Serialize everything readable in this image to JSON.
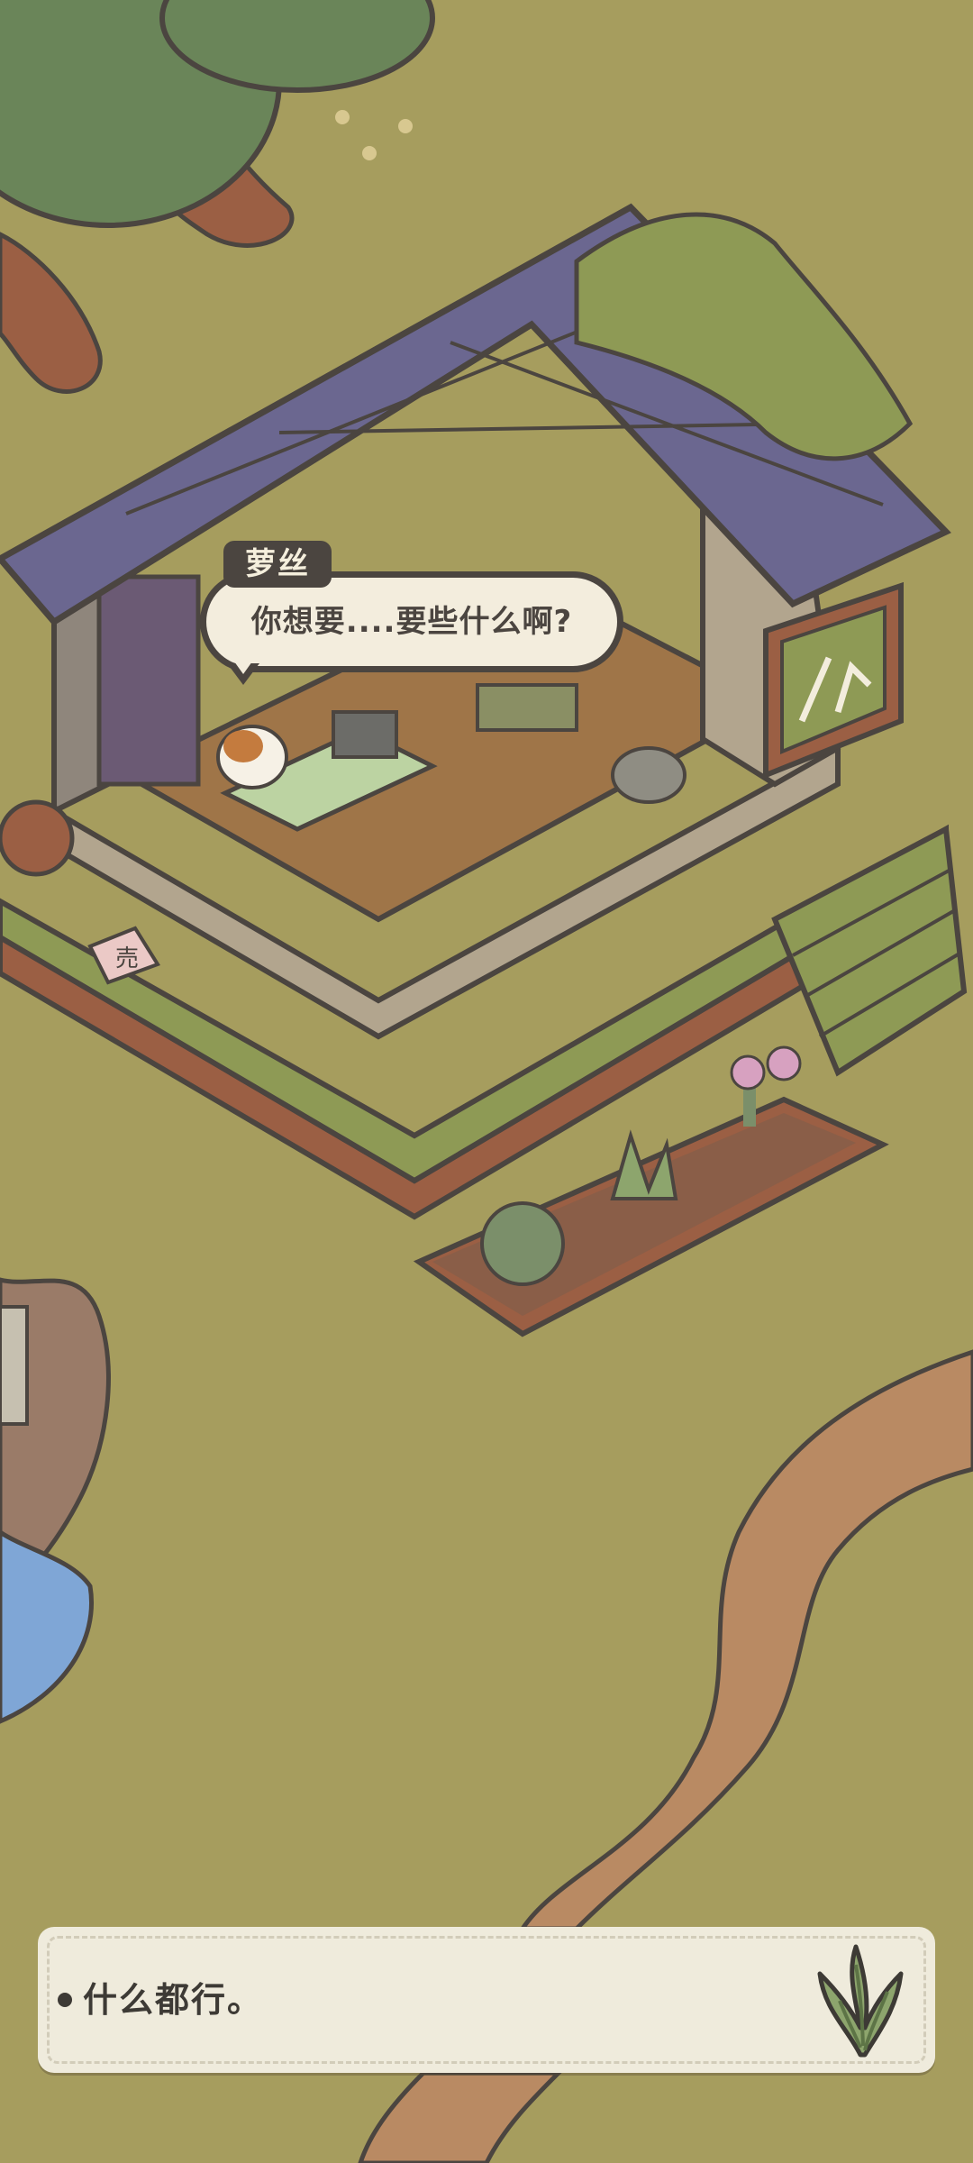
{
  "npc": {
    "name": "萝丝",
    "dialogue": "你想要....要些什么啊?"
  },
  "shop_sign_label": "売",
  "choices": [
    {
      "label": "什么都行。",
      "icon": "grass-tuft-icon"
    }
  ],
  "colors": {
    "grass": "#a69d5e",
    "dirt_path": "#b98a63",
    "roof": "#6b6790",
    "moss": "#8e9a55",
    "ui_panel": "#efebdc",
    "ui_text": "#3d3a35"
  }
}
